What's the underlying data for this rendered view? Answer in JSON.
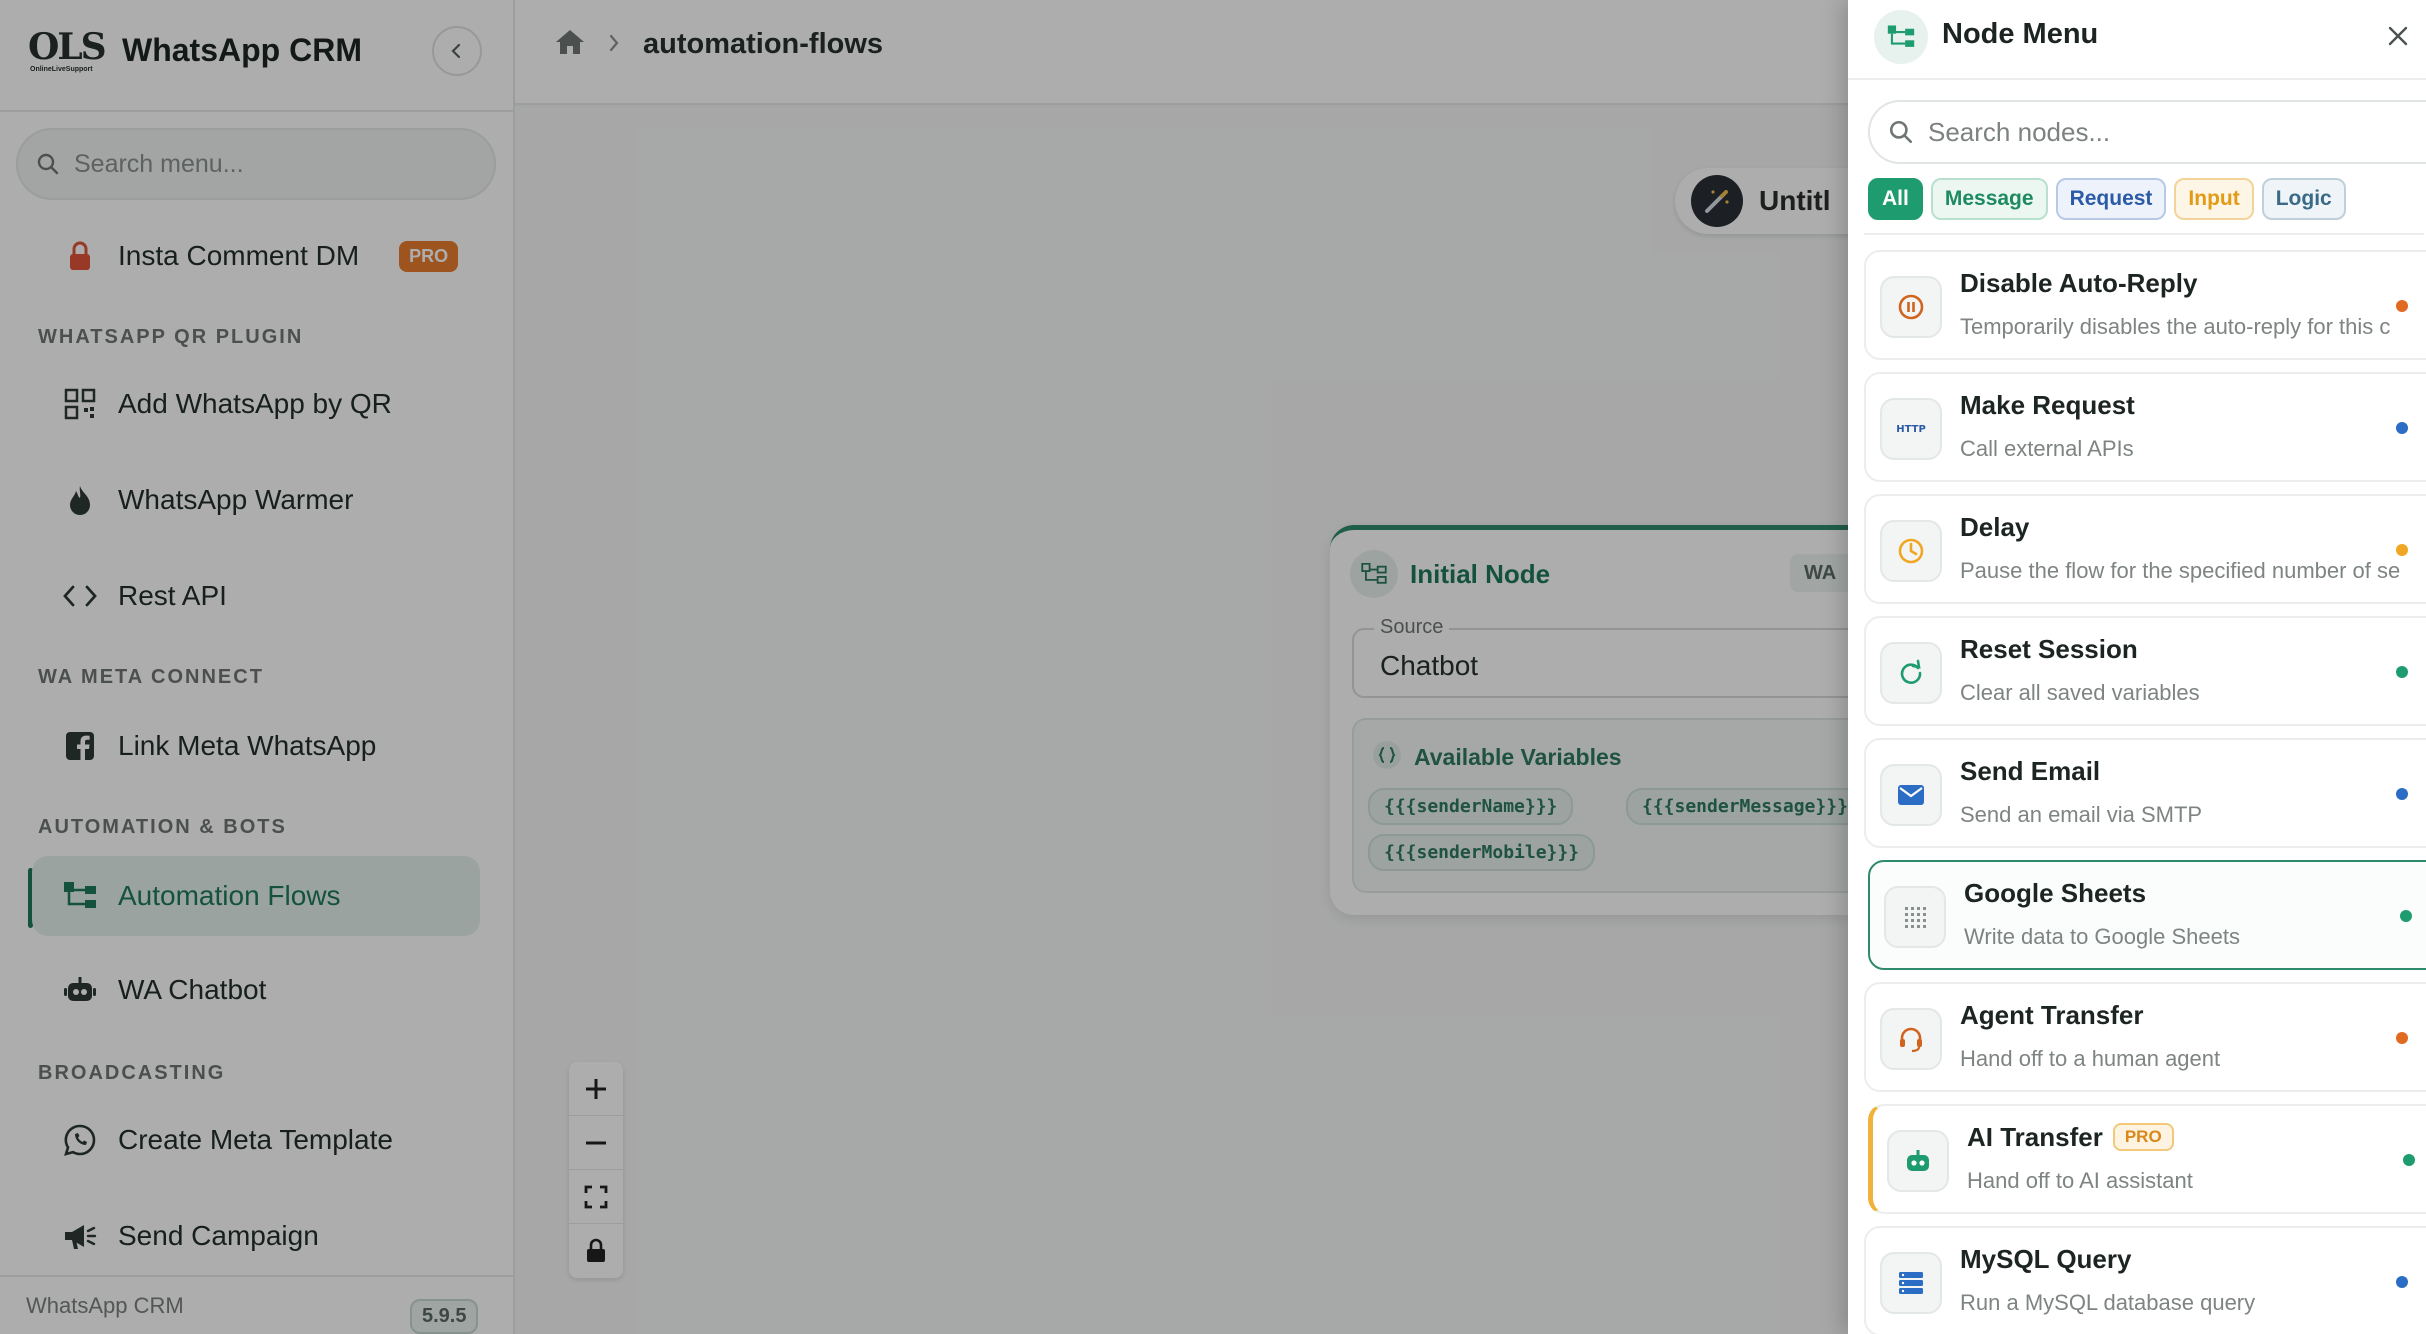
{
  "app": {
    "brand_logo_text": "OLS",
    "brand_logo_subtext": "OnlineLiveSupport",
    "brand_title": "WhatsApp CRM",
    "version": "5.9.5"
  },
  "sidebar": {
    "search_placeholder": "Search menu...",
    "items": [
      {
        "label": "Insta Comment DM",
        "badge": "PRO",
        "icon": "lock-icon"
      },
      {
        "label": "Add WhatsApp by QR",
        "icon": "qr-code-icon"
      },
      {
        "label": "WhatsApp Warmer",
        "icon": "flame-icon"
      },
      {
        "label": "Rest API",
        "icon": "code-icon"
      },
      {
        "label": "Link Meta WhatsApp",
        "icon": "facebook-icon"
      },
      {
        "label": "Automation Flows",
        "icon": "flow-icon",
        "active": true
      },
      {
        "label": "WA Chatbot",
        "icon": "robot-icon"
      },
      {
        "label": "Create Meta Template",
        "icon": "whatsapp-icon"
      },
      {
        "label": "Send Campaign",
        "icon": "megaphone-icon"
      }
    ],
    "sections": {
      "qr_plugin": "WHATSAPP QR PLUGIN",
      "meta_connect": "WA META CONNECT",
      "automation": "AUTOMATION & BOTS",
      "broadcasting": "BROADCASTING"
    },
    "footer_label": "WhatsApp CRM"
  },
  "header": {
    "breadcrumb_page": "automation-flows"
  },
  "canvas": {
    "flow_title": "Untitl",
    "node": {
      "title": "Initial Node",
      "tag": "WA",
      "source_label": "Source",
      "source_value": "Chatbot",
      "variables_title": "Available Variables",
      "variables": [
        "{{{senderName}}}",
        "{{{senderMessage}}}",
        "{{{senderMobile}}}"
      ]
    }
  },
  "node_menu": {
    "title": "Node Menu",
    "search_placeholder": "Search nodes...",
    "filters": [
      "All",
      "Message",
      "Request",
      "Input",
      "Logic"
    ],
    "active_filter": "All",
    "nodes": [
      {
        "title": "Disable Auto-Reply",
        "desc": "Temporarily disables the auto-reply for this c",
        "icon": "pause-icon",
        "dot": "#e06a1f"
      },
      {
        "title": "Make Request",
        "desc": "Call external APIs",
        "icon": "http-icon",
        "dot": "#2b6cc4"
      },
      {
        "title": "Delay",
        "desc": "Pause the flow for the specified number of se",
        "icon": "clock-icon",
        "dot": "#f0a623"
      },
      {
        "title": "Reset Session",
        "desc": "Clear all saved variables",
        "icon": "refresh-icon",
        "dot": "#1e9c6f"
      },
      {
        "title": "Send Email",
        "desc": "Send an email via SMTP",
        "icon": "mail-icon",
        "dot": "#2b6cc4"
      },
      {
        "title": "Google Sheets",
        "desc": "Write data to Google Sheets",
        "icon": "grid-icon",
        "dot": "#1e9c6f"
      },
      {
        "title": "Agent Transfer",
        "desc": "Hand off to a human agent",
        "icon": "headset-icon",
        "dot": "#e06a1f"
      },
      {
        "title": "AI Transfer",
        "badge": "PRO",
        "desc": "Hand off to AI assistant",
        "icon": "bot-icon",
        "dot": "#1e9c6f"
      },
      {
        "title": "MySQL Query",
        "desc": "Run a MySQL database query",
        "icon": "database-icon",
        "dot": "#2b6cc4"
      }
    ]
  },
  "colors": {
    "brand_green": "#1f7a5c",
    "pro_orange": "#e87c2f"
  }
}
